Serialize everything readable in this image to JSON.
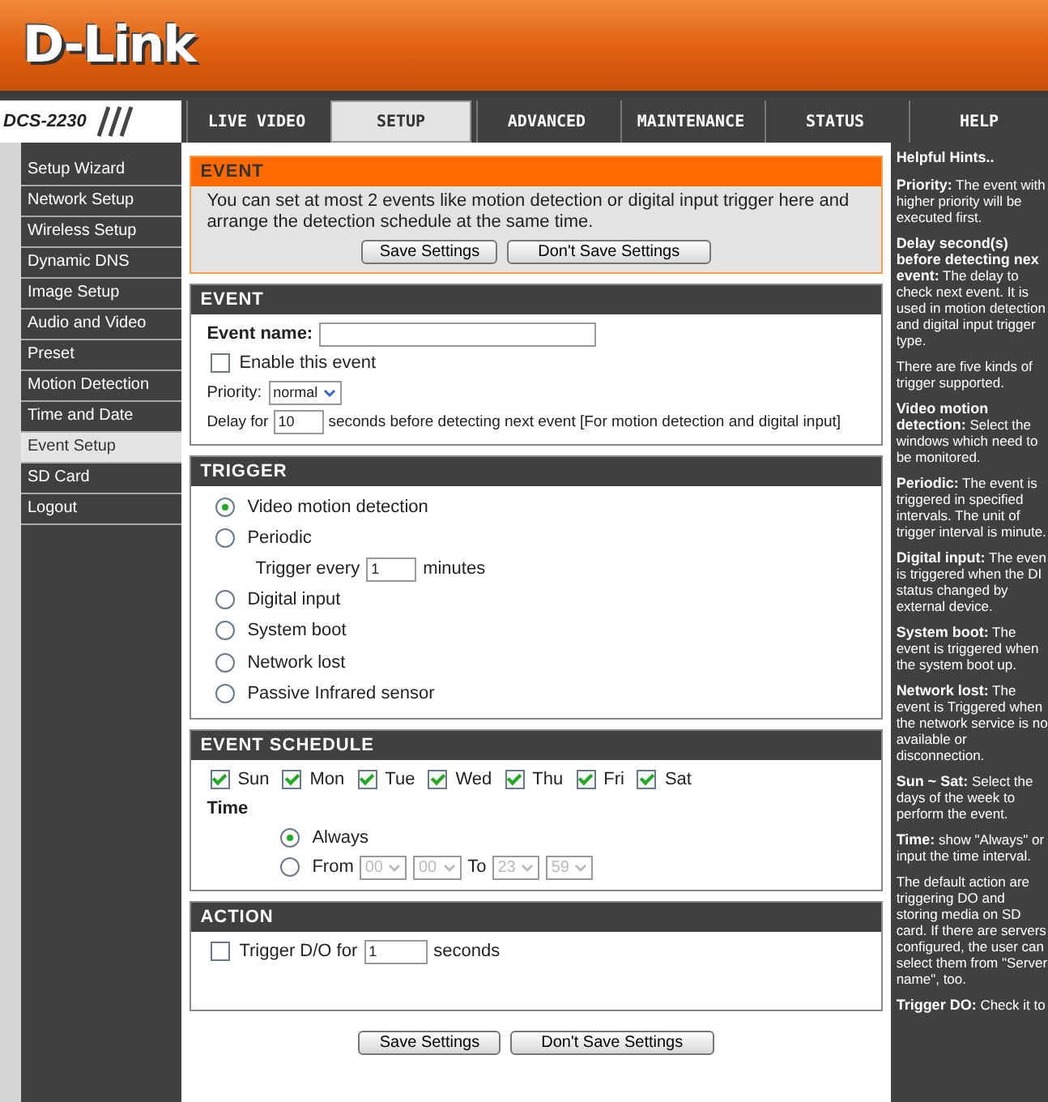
{
  "logo": "D-Link",
  "model": "DCS-2230",
  "tabs": [
    {
      "label": "LIVE VIDEO",
      "selected": false
    },
    {
      "label": "SETUP",
      "selected": true
    },
    {
      "label": "ADVANCED",
      "selected": false
    },
    {
      "label": "MAINTENANCE",
      "selected": false
    },
    {
      "label": "STATUS",
      "selected": false
    },
    {
      "label": "HELP",
      "selected": false
    }
  ],
  "sidebar": {
    "items": [
      {
        "label": "Setup Wizard",
        "selected": false
      },
      {
        "label": "Network Setup",
        "selected": false
      },
      {
        "label": "Wireless Setup",
        "selected": false
      },
      {
        "label": "Dynamic DNS",
        "selected": false
      },
      {
        "label": "Image Setup",
        "selected": false
      },
      {
        "label": "Audio and Video",
        "selected": false
      },
      {
        "label": "Preset",
        "selected": false
      },
      {
        "label": "Motion Detection",
        "selected": false
      },
      {
        "label": "Time and Date",
        "selected": false
      },
      {
        "label": "Event Setup",
        "selected": true
      },
      {
        "label": "SD Card",
        "selected": false
      },
      {
        "label": "Logout",
        "selected": false
      }
    ]
  },
  "notice": {
    "title": "EVENT",
    "text": "You can set at most 2 events like motion detection or digital input trigger here and arrange the detection schedule at the same time.",
    "buttons": [
      "Save Settings",
      "Don't Save Settings"
    ]
  },
  "event": {
    "title": "EVENT",
    "name_label": "Event name:",
    "enable": {
      "label": "Enable this event",
      "checked": false
    },
    "priority_label": "Priority:",
    "priority": "normal",
    "delay_prefix": "Delay for",
    "delay": "10",
    "delay_suffix": "seconds before detecting next event [For motion detection and digital input]"
  },
  "trigger": {
    "title": "TRIGGER",
    "options": [
      {
        "label": "Video motion detection",
        "selected": true
      },
      {
        "label": "Periodic",
        "selected": false,
        "sub": {
          "prefix": "Trigger every",
          "value": "1",
          "suffix": "minutes"
        }
      },
      {
        "label": "Digital input",
        "selected": false
      },
      {
        "label": "System boot",
        "selected": false
      },
      {
        "label": "Network lost",
        "selected": false
      },
      {
        "label": "Passive Infrared sensor",
        "selected": false
      }
    ]
  },
  "schedule": {
    "title": "EVENT SCHEDULE",
    "days": [
      {
        "label": "Sun",
        "checked": true
      },
      {
        "label": "Mon",
        "checked": true
      },
      {
        "label": "Tue",
        "checked": true
      },
      {
        "label": "Wed",
        "checked": true
      },
      {
        "label": "Thu",
        "checked": true
      },
      {
        "label": "Fri",
        "checked": true
      },
      {
        "label": "Sat",
        "checked": true
      }
    ],
    "time_label": "Time",
    "modes": [
      {
        "kind": "always",
        "label": "Always",
        "selected": true
      },
      {
        "kind": "range",
        "label": "From",
        "selected": false,
        "disabled": true,
        "from": [
          "00",
          "00"
        ],
        "to_label": "To",
        "to": [
          "23",
          "59"
        ]
      }
    ]
  },
  "action": {
    "title": "ACTION",
    "trigger_do": {
      "label": "Trigger D/O for",
      "checked": false,
      "value": "1",
      "suffix": "seconds"
    }
  },
  "buttons": [
    "Save Settings",
    "Don't Save Settings"
  ],
  "help": {
    "title": "Helpful Hints..",
    "hints": [
      "**Priority:** The event with higher priority will be executed first.",
      "**Delay second(s) before detecting nex event:** The delay to check next event. It is used in motion detection and digital input trigger type.",
      "There are five kinds of trigger supported.",
      "**Video motion detection:** Select the windows which need to be monitored.",
      "**Periodic:** The event is triggered in specified intervals. The unit of trigger interval is minute.",
      "**Digital input:** The even is triggered when the DI status changed by external device.",
      "**System boot:** The event is triggered when the system boot up.",
      "**Network lost:** The event is Triggered when the network service is no available or disconnection.",
      "**Sun ~ Sat:** Select the days of the week to perform the event.",
      "**Time:** show \"Always\" or input the time interval.",
      "The default action are triggering DO and storing media on SD card. If there are servers configured, the user can select them from \"Server name\", too.",
      "**Trigger DO:** Check it to"
    ]
  }
}
